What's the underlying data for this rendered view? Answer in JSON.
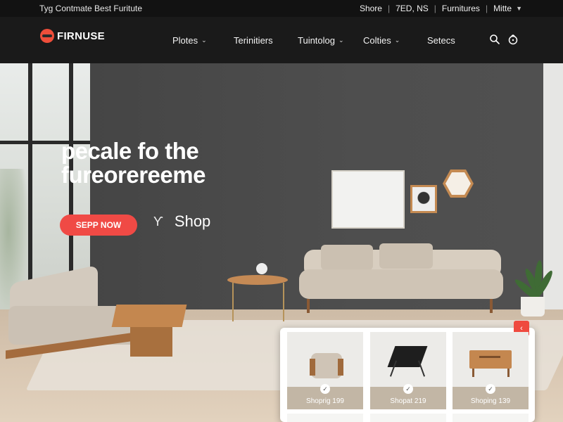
{
  "topbar": {
    "tagline": "Tyg Contmate Best Furitute",
    "links": [
      "Shore",
      "7ED, NS",
      "Furnitures",
      "Mitte"
    ]
  },
  "nav": {
    "logo": "FIRNUSE",
    "items": [
      {
        "label": "Plotes",
        "has_dropdown": true
      },
      {
        "label": "Terinitiers",
        "has_dropdown": false
      },
      {
        "label": "Tuintolog",
        "has_dropdown": true
      },
      {
        "label": "Colties",
        "has_dropdown": true
      },
      {
        "label": "Setecs",
        "has_dropdown": false
      }
    ],
    "icons": [
      "search-icon",
      "cart-icon"
    ]
  },
  "hero": {
    "title_line1": "pecale fo the",
    "title_line2": "fureorereeme",
    "cta_label": "SEPP NOW",
    "shop_label": "Shop"
  },
  "products": [
    {
      "label": "Shoprig 199",
      "image": "armchair"
    },
    {
      "label": "Shopat 219",
      "image": "sling-chair"
    },
    {
      "label": "Shoping 139",
      "image": "side-table"
    }
  ],
  "colors": {
    "accent": "#f04a45",
    "nav_bg": "#1a1a1a",
    "wall": "#4a4a4a",
    "card_label_bg": "#c2b6a5"
  }
}
